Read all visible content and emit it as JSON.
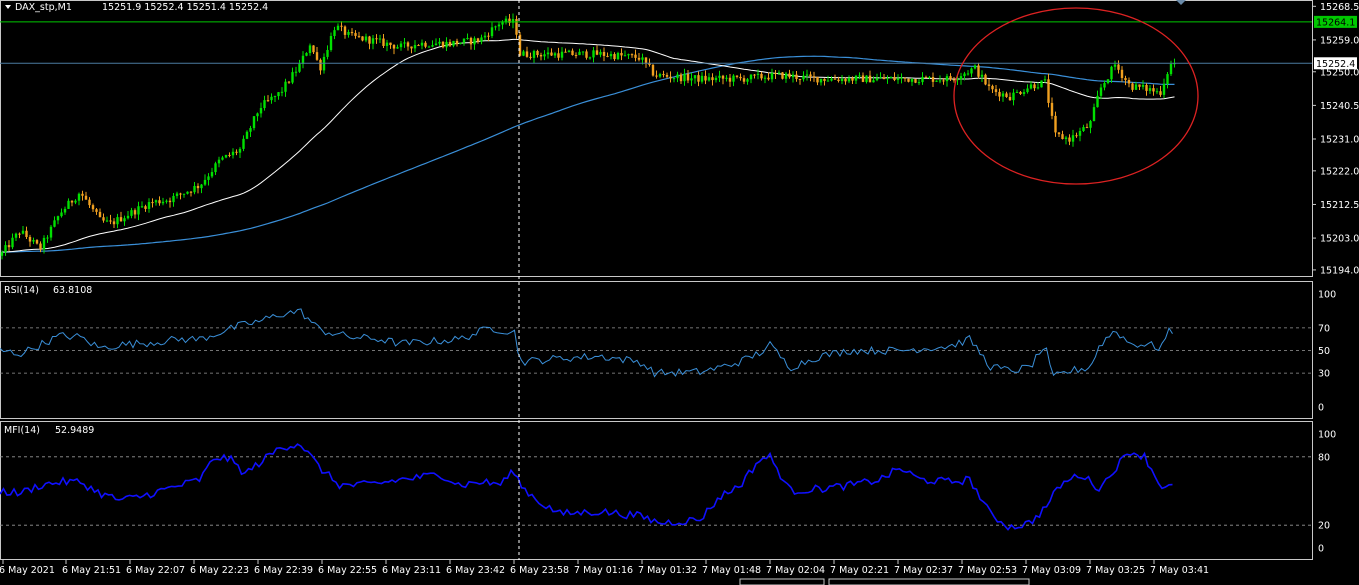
{
  "header": {
    "symbol": "DAX_stp,M1",
    "ohlc": "15251.9 15252.4 15251.4 15252.4"
  },
  "colors": {
    "background": "#000000",
    "frame": "#c8c8c8",
    "text": "#ffffff",
    "bull": "#00e000",
    "bear": "#f0a020",
    "ma_slow": "#3a8fd8",
    "ma_fast": "#ffffff",
    "rsi": "#3a8fd8",
    "mfi": "#1010ff",
    "resistance": "#00c800",
    "current_line": "#4a7aa0",
    "annotation": "#dd2222"
  },
  "chart_data": [
    {
      "type": "candlestick",
      "name": "DAX_stp,M1",
      "y_ticks": [
        "15268.5",
        "15259.0",
        "15250.0",
        "15240.5",
        "15231.0",
        "15222.0",
        "15212.5",
        "15203.0",
        "15194.0"
      ],
      "ylim": [
        15192.0,
        15270.0
      ],
      "overlays": [
        "moving-average-fast",
        "moving-average-slow"
      ],
      "price_labels": [
        {
          "value": 15264.1,
          "label": "15264.1",
          "kind": "resistance"
        },
        {
          "value": 15252.4,
          "label": "15252.4",
          "kind": "current"
        }
      ],
      "annotation": "red-ellipse",
      "anchors": [
        [
          0,
          15198
        ],
        [
          20,
          15205
        ],
        [
          40,
          15200
        ],
        [
          60,
          15210
        ],
        [
          80,
          15216
        ],
        [
          100,
          15208
        ],
        [
          110,
          15207
        ],
        [
          130,
          15210
        ],
        [
          150,
          15213
        ],
        [
          170,
          15214
        ],
        [
          200,
          15218
        ],
        [
          220,
          15225
        ],
        [
          240,
          15228
        ],
        [
          260,
          15240
        ],
        [
          280,
          15244
        ],
        [
          300,
          15252
        ],
        [
          310,
          15258
        ],
        [
          320,
          15251
        ],
        [
          335,
          15263
        ],
        [
          350,
          15260
        ],
        [
          370,
          15259
        ],
        [
          400,
          15257
        ],
        [
          420,
          15258
        ],
        [
          450,
          15258
        ],
        [
          480,
          15259
        ],
        [
          500,
          15264
        ],
        [
          515,
          15264
        ],
        [
          520,
          15255
        ],
        [
          560,
          15255
        ],
        [
          600,
          15255
        ],
        [
          640,
          15254
        ],
        [
          655,
          15249
        ],
        [
          700,
          15248
        ],
        [
          740,
          15248
        ],
        [
          780,
          15249
        ],
        [
          820,
          15248
        ],
        [
          860,
          15248
        ],
        [
          900,
          15248
        ],
        [
          950,
          15248
        ],
        [
          975,
          15251
        ],
        [
          990,
          15245
        ],
        [
          1010,
          15243
        ],
        [
          1030,
          15246
        ],
        [
          1045,
          15247
        ],
        [
          1055,
          15232
        ],
        [
          1070,
          15231
        ],
        [
          1090,
          15235
        ],
        [
          1100,
          15245
        ],
        [
          1115,
          15252
        ],
        [
          1130,
          15246
        ],
        [
          1150,
          15245
        ],
        [
          1160,
          15244
        ],
        [
          1170,
          15252
        ],
        [
          1175,
          15252.4
        ]
      ]
    },
    {
      "type": "line",
      "name": "RSI(14)",
      "value_label": "63.8108",
      "y_ticks": [
        "100",
        "70",
        "50",
        "30",
        "0"
      ],
      "levels": [
        70,
        50,
        30
      ],
      "ylim": [
        0,
        100
      ],
      "anchors": [
        [
          0,
          50
        ],
        [
          20,
          47
        ],
        [
          40,
          55
        ],
        [
          60,
          63
        ],
        [
          80,
          62
        ],
        [
          100,
          52
        ],
        [
          120,
          55
        ],
        [
          150,
          57
        ],
        [
          180,
          60
        ],
        [
          200,
          60
        ],
        [
          220,
          66
        ],
        [
          240,
          72
        ],
        [
          260,
          76
        ],
        [
          280,
          82
        ],
        [
          300,
          85
        ],
        [
          320,
          68
        ],
        [
          350,
          62
        ],
        [
          380,
          60
        ],
        [
          400,
          56
        ],
        [
          430,
          58
        ],
        [
          460,
          60
        ],
        [
          490,
          70
        ],
        [
          515,
          66
        ],
        [
          520,
          40
        ],
        [
          560,
          43
        ],
        [
          600,
          45
        ],
        [
          640,
          40
        ],
        [
          655,
          30
        ],
        [
          700,
          31
        ],
        [
          720,
          35
        ],
        [
          740,
          40
        ],
        [
          760,
          48
        ],
        [
          770,
          55
        ],
        [
          790,
          35
        ],
        [
          820,
          45
        ],
        [
          850,
          50
        ],
        [
          900,
          50
        ],
        [
          950,
          54
        ],
        [
          970,
          60
        ],
        [
          990,
          36
        ],
        [
          1010,
          32
        ],
        [
          1030,
          35
        ],
        [
          1045,
          55
        ],
        [
          1052,
          26
        ],
        [
          1070,
          32
        ],
        [
          1090,
          35
        ],
        [
          1100,
          55
        ],
        [
          1115,
          68
        ],
        [
          1130,
          56
        ],
        [
          1150,
          55
        ],
        [
          1160,
          52
        ],
        [
          1170,
          68
        ],
        [
          1175,
          63.8
        ]
      ]
    },
    {
      "type": "line",
      "name": "MFI(14)",
      "value_label": "52.9489",
      "y_ticks": [
        "100",
        "80",
        "20",
        "0"
      ],
      "levels": [
        80,
        20
      ],
      "ylim": [
        0,
        100
      ],
      "anchors": [
        [
          0,
          50
        ],
        [
          20,
          48
        ],
        [
          40,
          55
        ],
        [
          60,
          58
        ],
        [
          80,
          58
        ],
        [
          100,
          48
        ],
        [
          120,
          42
        ],
        [
          140,
          45
        ],
        [
          160,
          50
        ],
        [
          180,
          55
        ],
        [
          200,
          60
        ],
        [
          215,
          80
        ],
        [
          230,
          78
        ],
        [
          245,
          65
        ],
        [
          260,
          75
        ],
        [
          280,
          88
        ],
        [
          300,
          92
        ],
        [
          320,
          70
        ],
        [
          340,
          55
        ],
        [
          360,
          55
        ],
        [
          380,
          57
        ],
        [
          400,
          60
        ],
        [
          420,
          62
        ],
        [
          440,
          65
        ],
        [
          460,
          55
        ],
        [
          480,
          58
        ],
        [
          500,
          56
        ],
        [
          515,
          68
        ],
        [
          520,
          55
        ],
        [
          540,
          40
        ],
        [
          560,
          30
        ],
        [
          600,
          32
        ],
        [
          640,
          28
        ],
        [
          660,
          22
        ],
        [
          700,
          25
        ],
        [
          720,
          45
        ],
        [
          740,
          55
        ],
        [
          760,
          78
        ],
        [
          770,
          80
        ],
        [
          790,
          50
        ],
        [
          820,
          52
        ],
        [
          850,
          55
        ],
        [
          880,
          60
        ],
        [
          900,
          70
        ],
        [
          920,
          60
        ],
        [
          950,
          58
        ],
        [
          970,
          60
        ],
        [
          990,
          30
        ],
        [
          1010,
          18
        ],
        [
          1030,
          22
        ],
        [
          1045,
          35
        ],
        [
          1060,
          55
        ],
        [
          1080,
          65
        ],
        [
          1100,
          52
        ],
        [
          1115,
          70
        ],
        [
          1130,
          85
        ],
        [
          1145,
          80
        ],
        [
          1160,
          55
        ],
        [
          1175,
          53
        ]
      ]
    }
  ],
  "time_axis": {
    "labels": [
      "6 May 2021",
      "6 May 21:51",
      "6 May 22:07",
      "6 May 22:23",
      "6 May 22:39",
      "6 May 22:55",
      "6 May 23:11",
      "6 May 23:42",
      "6 May 23:58",
      "7 May 01:16",
      "7 May 01:32",
      "7 May 01:48",
      "7 May 02:04",
      "7 May 02:21",
      "7 May 02:37",
      "7 May 02:53",
      "7 May 03:09",
      "7 May 03:25",
      "7 May 03:41"
    ]
  }
}
